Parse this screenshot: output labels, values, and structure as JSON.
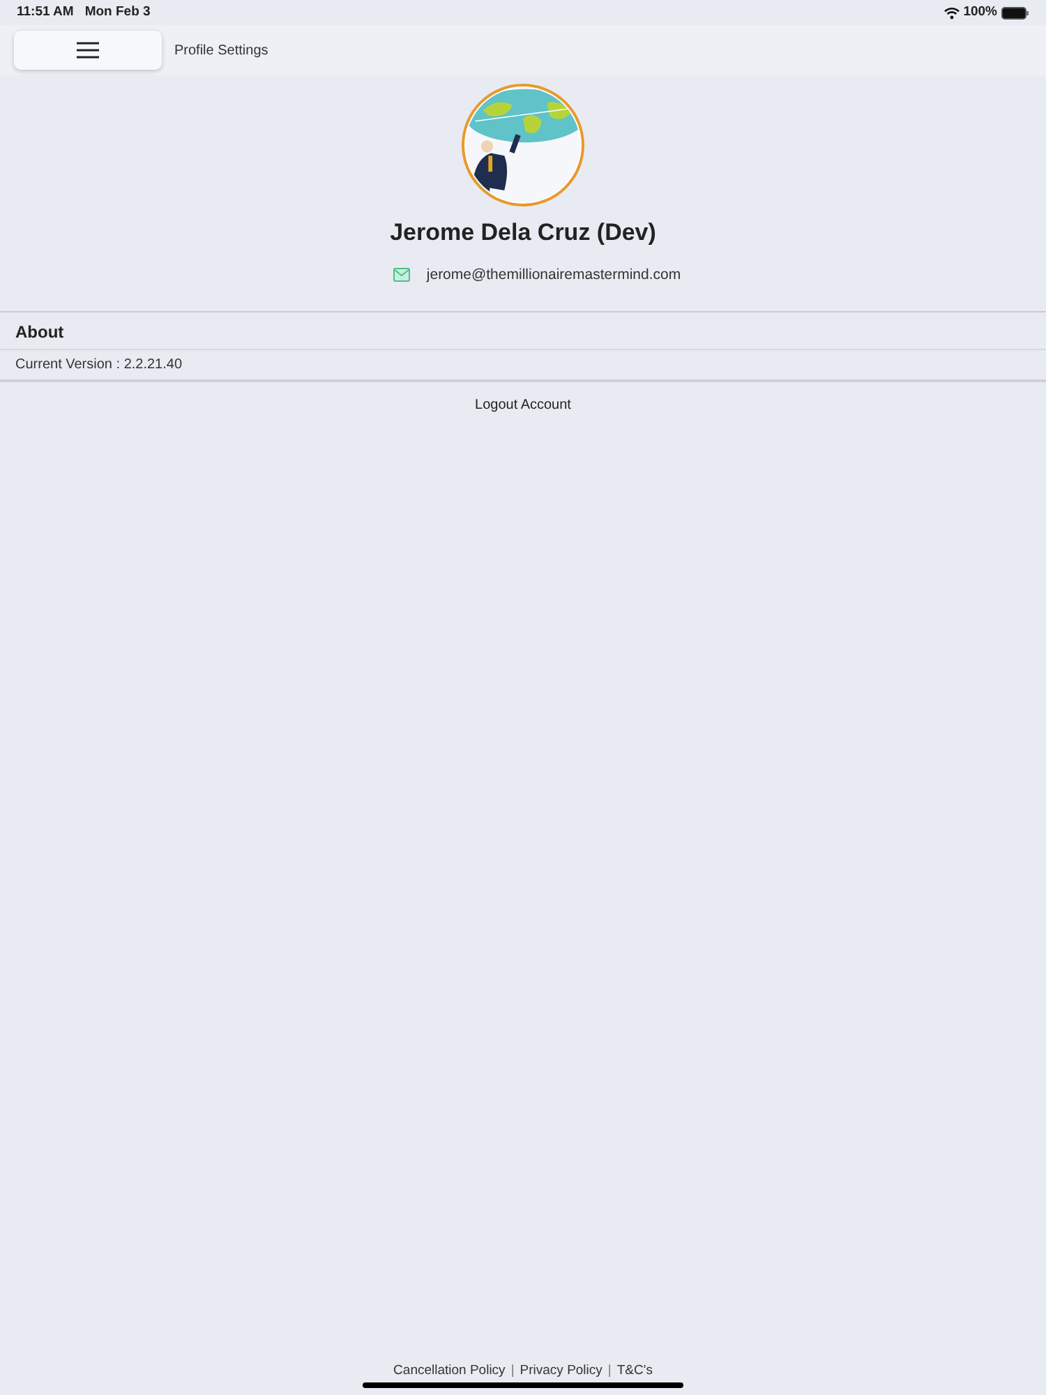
{
  "status_bar": {
    "time": "11:51 AM",
    "date": "Mon Feb 3",
    "battery": "100%"
  },
  "header": {
    "title": "Profile Settings"
  },
  "profile": {
    "name": "Jerome Dela Cruz (Dev)",
    "email": "jerome@themillionairemastermind.com"
  },
  "about": {
    "heading": "About",
    "version": "Current Version : 2.2.21.40"
  },
  "logout": "Logout Account",
  "footer": [
    {
      "kind": "link",
      "text": "Cancellation Policy"
    },
    {
      "kind": "separator",
      "text": "|"
    },
    {
      "kind": "link",
      "text": "Privacy Policy"
    },
    {
      "kind": "separator",
      "text": "|"
    },
    {
      "kind": "link",
      "text": "T&C's"
    }
  ]
}
